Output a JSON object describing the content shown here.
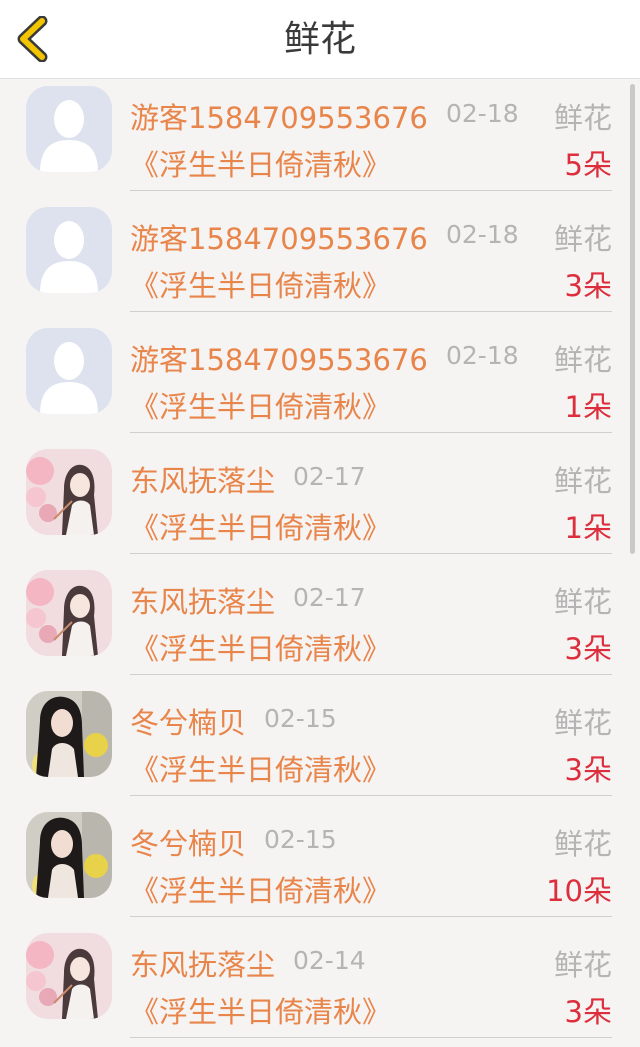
{
  "header": {
    "title": "鲜花",
    "back_icon": "chevron-left-icon",
    "accent": "#f2c500"
  },
  "colors": {
    "name": "#e8854a",
    "count": "#dc2e3c",
    "muted": "#b4b4b4"
  },
  "records": [
    {
      "name": "游客1584709553676",
      "date": "02-18",
      "type": "鲜花",
      "book": "《浮生半日倚清秋》",
      "count": "5朵",
      "avatar": "default"
    },
    {
      "name": "游客1584709553676",
      "date": "02-18",
      "type": "鲜花",
      "book": "《浮生半日倚清秋》",
      "count": "3朵",
      "avatar": "default"
    },
    {
      "name": "游客1584709553676",
      "date": "02-18",
      "type": "鲜花",
      "book": "《浮生半日倚清秋》",
      "count": "1朵",
      "avatar": "default"
    },
    {
      "name": "东风抚落尘",
      "date": "02-17",
      "type": "鲜花",
      "book": "《浮生半日倚清秋》",
      "count": "1朵",
      "avatar": "anime"
    },
    {
      "name": "东风抚落尘",
      "date": "02-17",
      "type": "鲜花",
      "book": "《浮生半日倚清秋》",
      "count": "3朵",
      "avatar": "anime"
    },
    {
      "name": "冬兮楠贝",
      "date": "02-15",
      "type": "鲜花",
      "book": "《浮生半日倚清秋》",
      "count": "3朵",
      "avatar": "photo"
    },
    {
      "name": "冬兮楠贝",
      "date": "02-15",
      "type": "鲜花",
      "book": "《浮生半日倚清秋》",
      "count": "10朵",
      "avatar": "photo"
    },
    {
      "name": "东风抚落尘",
      "date": "02-14",
      "type": "鲜花",
      "book": "《浮生半日倚清秋》",
      "count": "3朵",
      "avatar": "anime"
    }
  ]
}
